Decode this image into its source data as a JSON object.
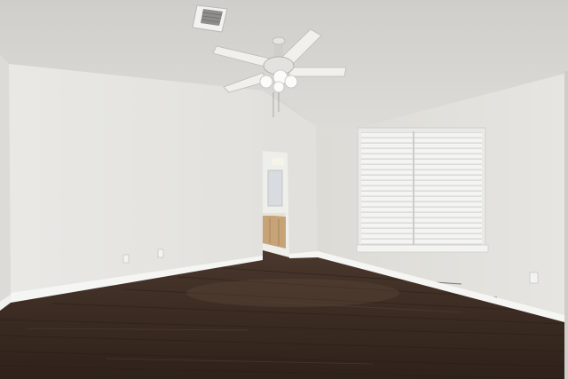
{
  "scene": {
    "description_type": "photo",
    "colors": {
      "ceiling": "#dcdbd7",
      "wall_left": "#e7e6e2",
      "wall_back": "#dddcd8",
      "wall_right": "#e3e2de",
      "floor": "#3d2c22",
      "floor_highlight": "#5a4538",
      "baseboard": "#f4f4f2",
      "window_blinds": "#f2f2f0",
      "cabinet": "#c9a878",
      "fan": "#f0efec"
    }
  }
}
